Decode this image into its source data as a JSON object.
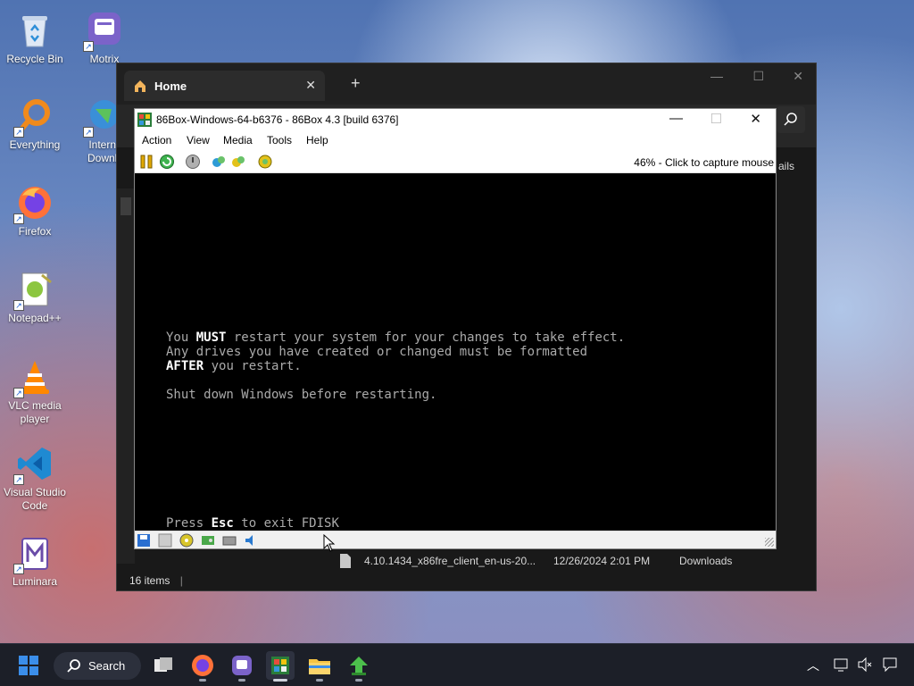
{
  "desktop": {
    "icons": [
      {
        "label": "Recycle Bin",
        "icon": "recycle-bin-icon"
      },
      {
        "label": "Motrix",
        "icon": "motrix-icon"
      },
      {
        "label": "Everything",
        "icon": "everything-search-icon"
      },
      {
        "label": "Interne Downlo",
        "icon": "internet-download-manager-icon"
      },
      {
        "label": "Firefox",
        "icon": "firefox-icon"
      },
      {
        "label": "Notepad++",
        "icon": "notepadpp-icon"
      },
      {
        "label": "VLC media player",
        "icon": "vlc-icon"
      },
      {
        "label": "Visual Studio Code",
        "icon": "vscode-icon"
      },
      {
        "label": "Luminara",
        "icon": "luminara-icon"
      }
    ]
  },
  "explorer": {
    "tab_title": "Home",
    "details_partial": "ails",
    "file": {
      "name": "4.10.1434_x86fre_client_en-us-20...",
      "date": "12/26/2024 2:01 PM",
      "location": "Downloads"
    },
    "status_items": "16 items"
  },
  "box86": {
    "title": "86Box-Windows-64-b6376 - 86Box 4.3 [build 6376]",
    "menu": [
      "Action",
      "View",
      "Media",
      "Tools",
      "Help"
    ],
    "capture_text": "46% - Click to capture mouse",
    "screen": {
      "line1_pre": "You ",
      "line1_bold": "MUST",
      "line1_post": " restart your system for your changes to take effect.",
      "line2": "Any drives you have created or changed must be formatted",
      "line3_bold": "AFTER",
      "line3_post": " you restart.",
      "line4": "Shut down Windows before restarting.",
      "line5_pre": "Press ",
      "line5_bold": "Esc",
      "line5_post": " to exit FDISK"
    }
  },
  "taskbar": {
    "search_label": "Search",
    "colors": {
      "bg": "#1c1f28",
      "accent": "#3b8eea"
    }
  }
}
